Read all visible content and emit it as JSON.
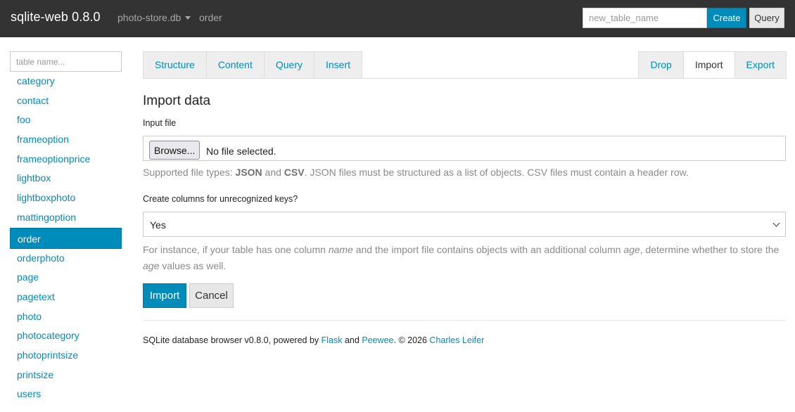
{
  "navbar": {
    "brand": "sqlite-web 0.8.0",
    "database": "photo-store.db",
    "current_table": "order",
    "new_table_placeholder": "new_table_name",
    "create_label": "Create",
    "query_label": "Query"
  },
  "sidebar": {
    "filter_placeholder": "table name...",
    "tables": [
      "category",
      "contact",
      "foo",
      "frameoption",
      "frameoptionprice",
      "lightbox",
      "lightboxphoto",
      "mattingoption",
      "order",
      "orderphoto",
      "page",
      "pagetext",
      "photo",
      "photocategory",
      "photoprintsize",
      "printsize",
      "users"
    ],
    "active_table": "order"
  },
  "tabs": {
    "left": [
      "Structure",
      "Content",
      "Query",
      "Insert"
    ],
    "right": [
      "Drop",
      "Import",
      "Export"
    ],
    "active": "Import"
  },
  "import_form": {
    "heading": "Import data",
    "file_label": "Input file",
    "browse_label": "Browse...",
    "file_status": "No file selected.",
    "help_prefix": "Supported file types: ",
    "help_json": "JSON",
    "help_and": " and ",
    "help_csv": "CSV",
    "help_suffix": ". JSON files must be structured as a list of objects. CSV files must contain a header row.",
    "columns_label": "Create columns for unrecognized keys?",
    "columns_value": "Yes",
    "help2_a": "For instance, if your table has one column ",
    "help2_name": "name",
    "help2_b": " and the import file contains objects with an additional column ",
    "help2_age": "age",
    "help2_c": ", determine whether to store the ",
    "help2_age2": "age",
    "help2_d": " values as well.",
    "import_label": "Import",
    "cancel_label": "Cancel"
  },
  "footer": {
    "prefix": "SQLite database browser v0.8.0, powered by ",
    "flask": "Flask",
    "and": " and ",
    "peewee": "Peewee",
    "copyright": ". © 2026 ",
    "author": "Charles Leifer"
  },
  "colors": {
    "navbar_bg": "#333333",
    "accent": "#008cba",
    "muted_text": "#8a8a8a"
  }
}
